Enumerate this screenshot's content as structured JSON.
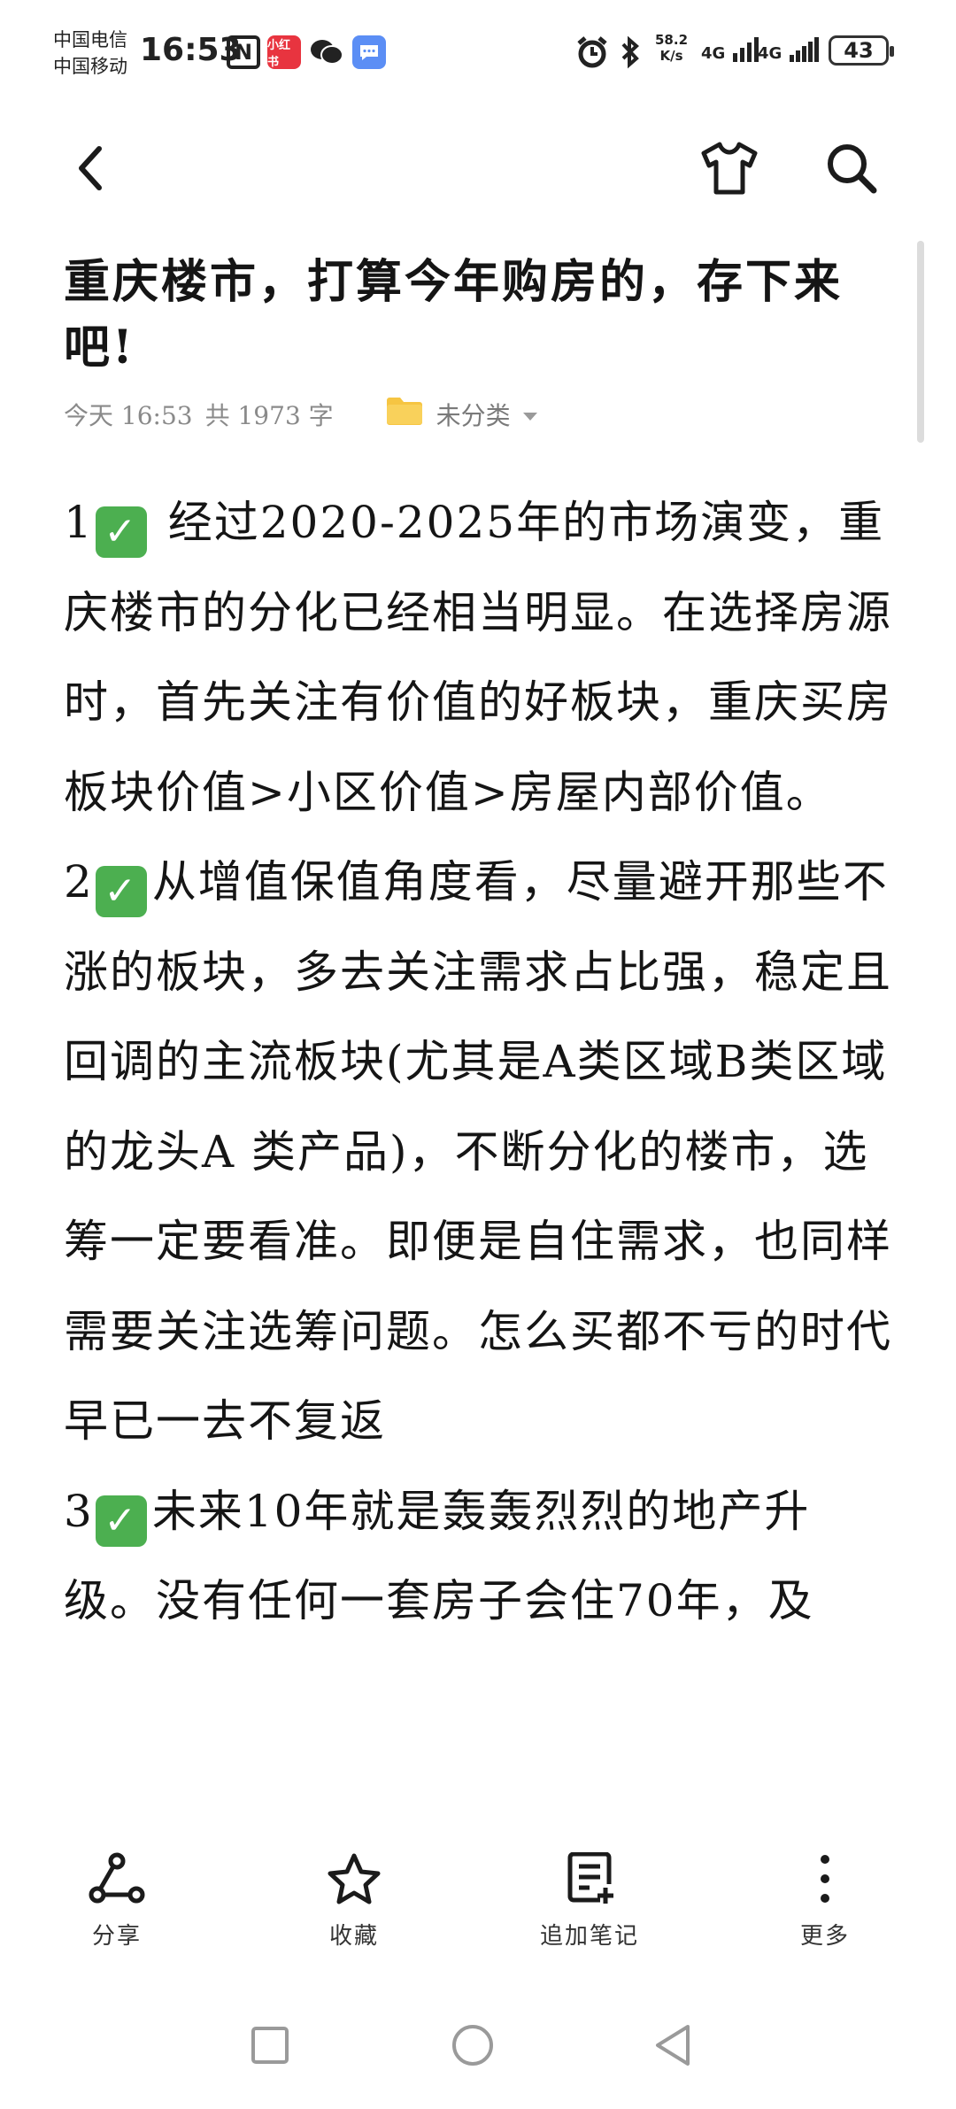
{
  "status_bar": {
    "carrier_1": "中国电信",
    "carrier_2": "中国移动",
    "time": "16:53",
    "xhs_label": "小红书",
    "net_speed_value": "58.2",
    "net_speed_unit": "K/s",
    "signal_1": "4G",
    "signal_2": "4G",
    "battery": "43"
  },
  "note": {
    "title": "重庆楼市，打算今年购房的，存下来吧!",
    "date": "今天 16:53",
    "word_count": "共 1973 字",
    "category": "未分类",
    "paragraphs": [
      {
        "num": "1",
        "text": " 经过2020-2025年的市场演变，重庆楼市的分化已经相当明显。在选择房源时，首先关注有价值的好板块，重庆买房板块价值>小区价值>房屋内部价值。"
      },
      {
        "num": "2",
        "text": "从增值保值角度看，尽量避开那些不涨的板块，多去关注需求占比强，稳定且回调的主流板块(尤其是A类区域B类区域的龙头A 类产品)，不断分化的楼市，选筹一定要看准。即便是自住需求，也同样需要关注选筹问题。怎么买都不亏的时代早已一去不复返"
      },
      {
        "num": "3",
        "text": "未来10年就是轰轰烈烈的地产升级。没有任何一套房子会住70年，及"
      }
    ]
  },
  "actions": {
    "share": "分享",
    "favorite": "收藏",
    "append_note": "追加笔记",
    "more": "更多"
  },
  "colors": {
    "check_green": "#4caf50",
    "folder_yellow": "#f6c542",
    "text": "#151515",
    "meta_gray": "#8a8a8a"
  }
}
